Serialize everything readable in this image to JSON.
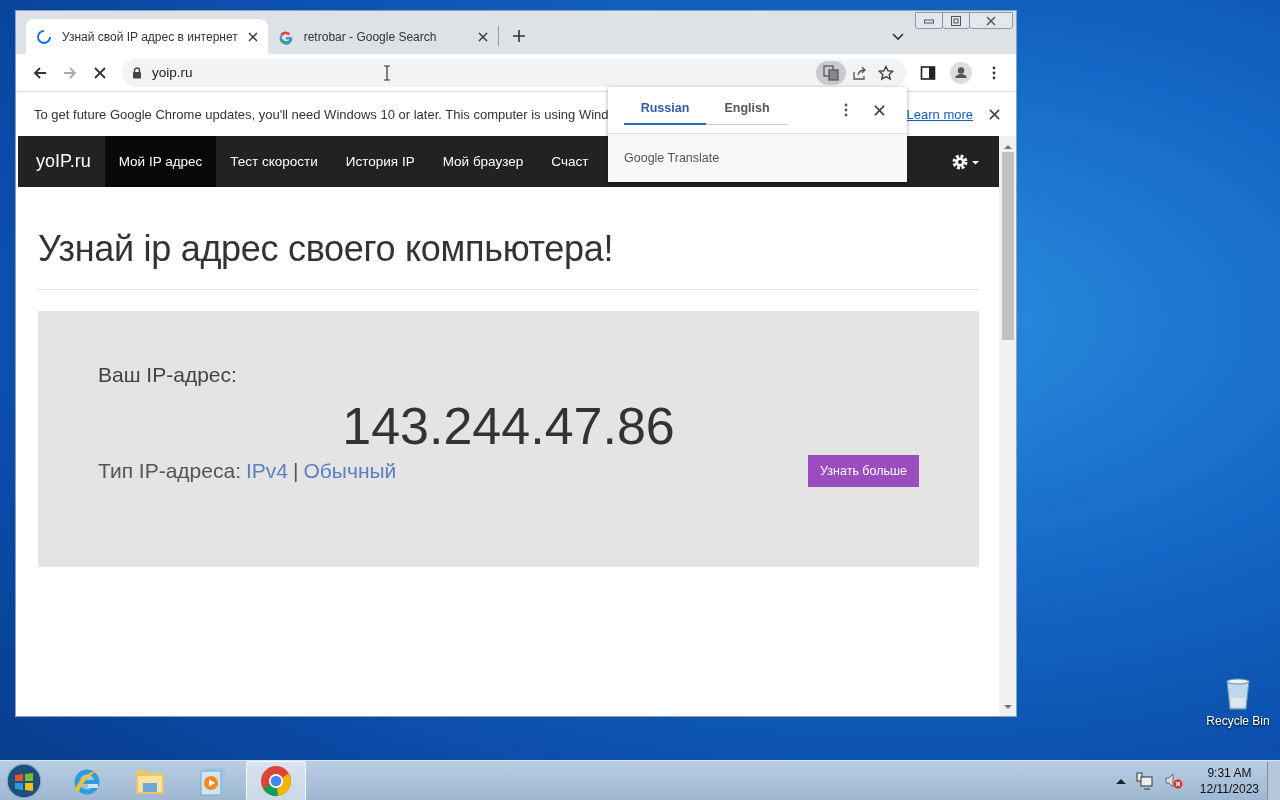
{
  "browser": {
    "tabs": [
      {
        "title": "Узнай свой IP адрес в интернет",
        "selected": true,
        "loading": true
      },
      {
        "title": "retrobar - Google Search",
        "selected": false,
        "loading": false
      }
    ],
    "address": "yoip.ru",
    "infobar": {
      "message": "To get future Google Chrome updates, you'll need Windows 10 or later. This computer is using Wind",
      "link": "Learn more"
    },
    "translate_popup": {
      "languages": [
        {
          "label": "Russian",
          "selected": true
        },
        {
          "label": "English",
          "selected": false
        }
      ],
      "brand": "Google Translate"
    }
  },
  "site": {
    "brand": "yoIP.ru",
    "nav": [
      {
        "label": "Мой IP адрес",
        "selected": true
      },
      {
        "label": "Тест скорости",
        "selected": false
      },
      {
        "label": "История IP",
        "selected": false
      },
      {
        "label": "Мой браузер",
        "selected": false
      },
      {
        "label": "Счаст",
        "selected": false
      }
    ],
    "heading": "Узнай ip адрес своего компьютера!",
    "ip_label": "Ваш IP-адрес:",
    "ip": "143.244.47.86",
    "type_label": "Тип IP-адреса:",
    "type_values": [
      "IPv4",
      "Обычный"
    ],
    "separator": "|",
    "button": "Узнать больше"
  },
  "desktop": {
    "icons": [
      {
        "label": "Recycle Bin"
      }
    ]
  },
  "taskbar": {
    "apps": [
      {
        "kind": "ie",
        "selected": false
      },
      {
        "kind": "explorer",
        "selected": false
      },
      {
        "kind": "media",
        "selected": false
      },
      {
        "kind": "chrome",
        "selected": true
      }
    ],
    "clock": {
      "time": "9:31 AM",
      "date": "12/11/2023"
    }
  }
}
